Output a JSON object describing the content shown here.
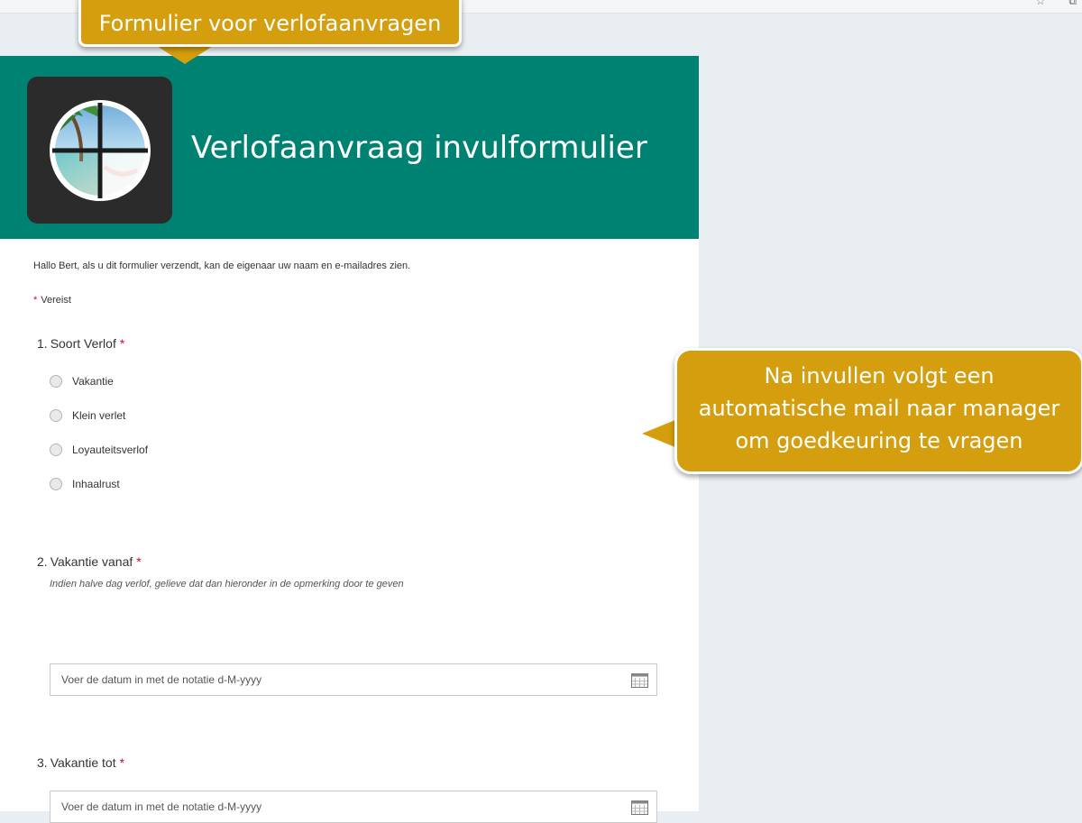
{
  "callouts": {
    "top": "Formulier voor verlofaanvragen",
    "right_lines": [
      "Na invullen volgt een",
      "automatische mail naar manager",
      "om goedkeuring te vragen"
    ]
  },
  "form": {
    "title": "Verlofaanvraag invulformulier",
    "intro": "Hallo Bert, als u dit formulier verzendt, kan de eigenaar uw naam en e-mailadres zien.",
    "required_star": "*",
    "required_label": "Vereist",
    "questions": [
      {
        "number": "1.",
        "title": "Soort Verlof",
        "required": "*",
        "options": [
          "Vakantie",
          "Klein verlet",
          "Loyauteitsverlof",
          "Inhaalrust"
        ]
      },
      {
        "number": "2.",
        "title": "Vakantie vanaf",
        "required": "*",
        "hint": "Indien halve dag verlof, gelieve dat dan hieronder in de opmerking door te geven",
        "placeholder": "Voer de datum in met de notatie d-M-yyyy",
        "value": ""
      },
      {
        "number": "3.",
        "title": "Vakantie tot",
        "required": "*",
        "placeholder": "Voer de datum in met de notatie d-M-yyyy",
        "value": ""
      }
    ]
  },
  "colors": {
    "header": "#008272",
    "callout": "#d49e0e",
    "required": "#c8102e",
    "page_bg": "#e8eef2"
  },
  "icons": {
    "logo": "beach-vacation-logo",
    "calendar": "calendar-icon",
    "bookmark": "star-icon",
    "extension": "puzzle-icon"
  }
}
